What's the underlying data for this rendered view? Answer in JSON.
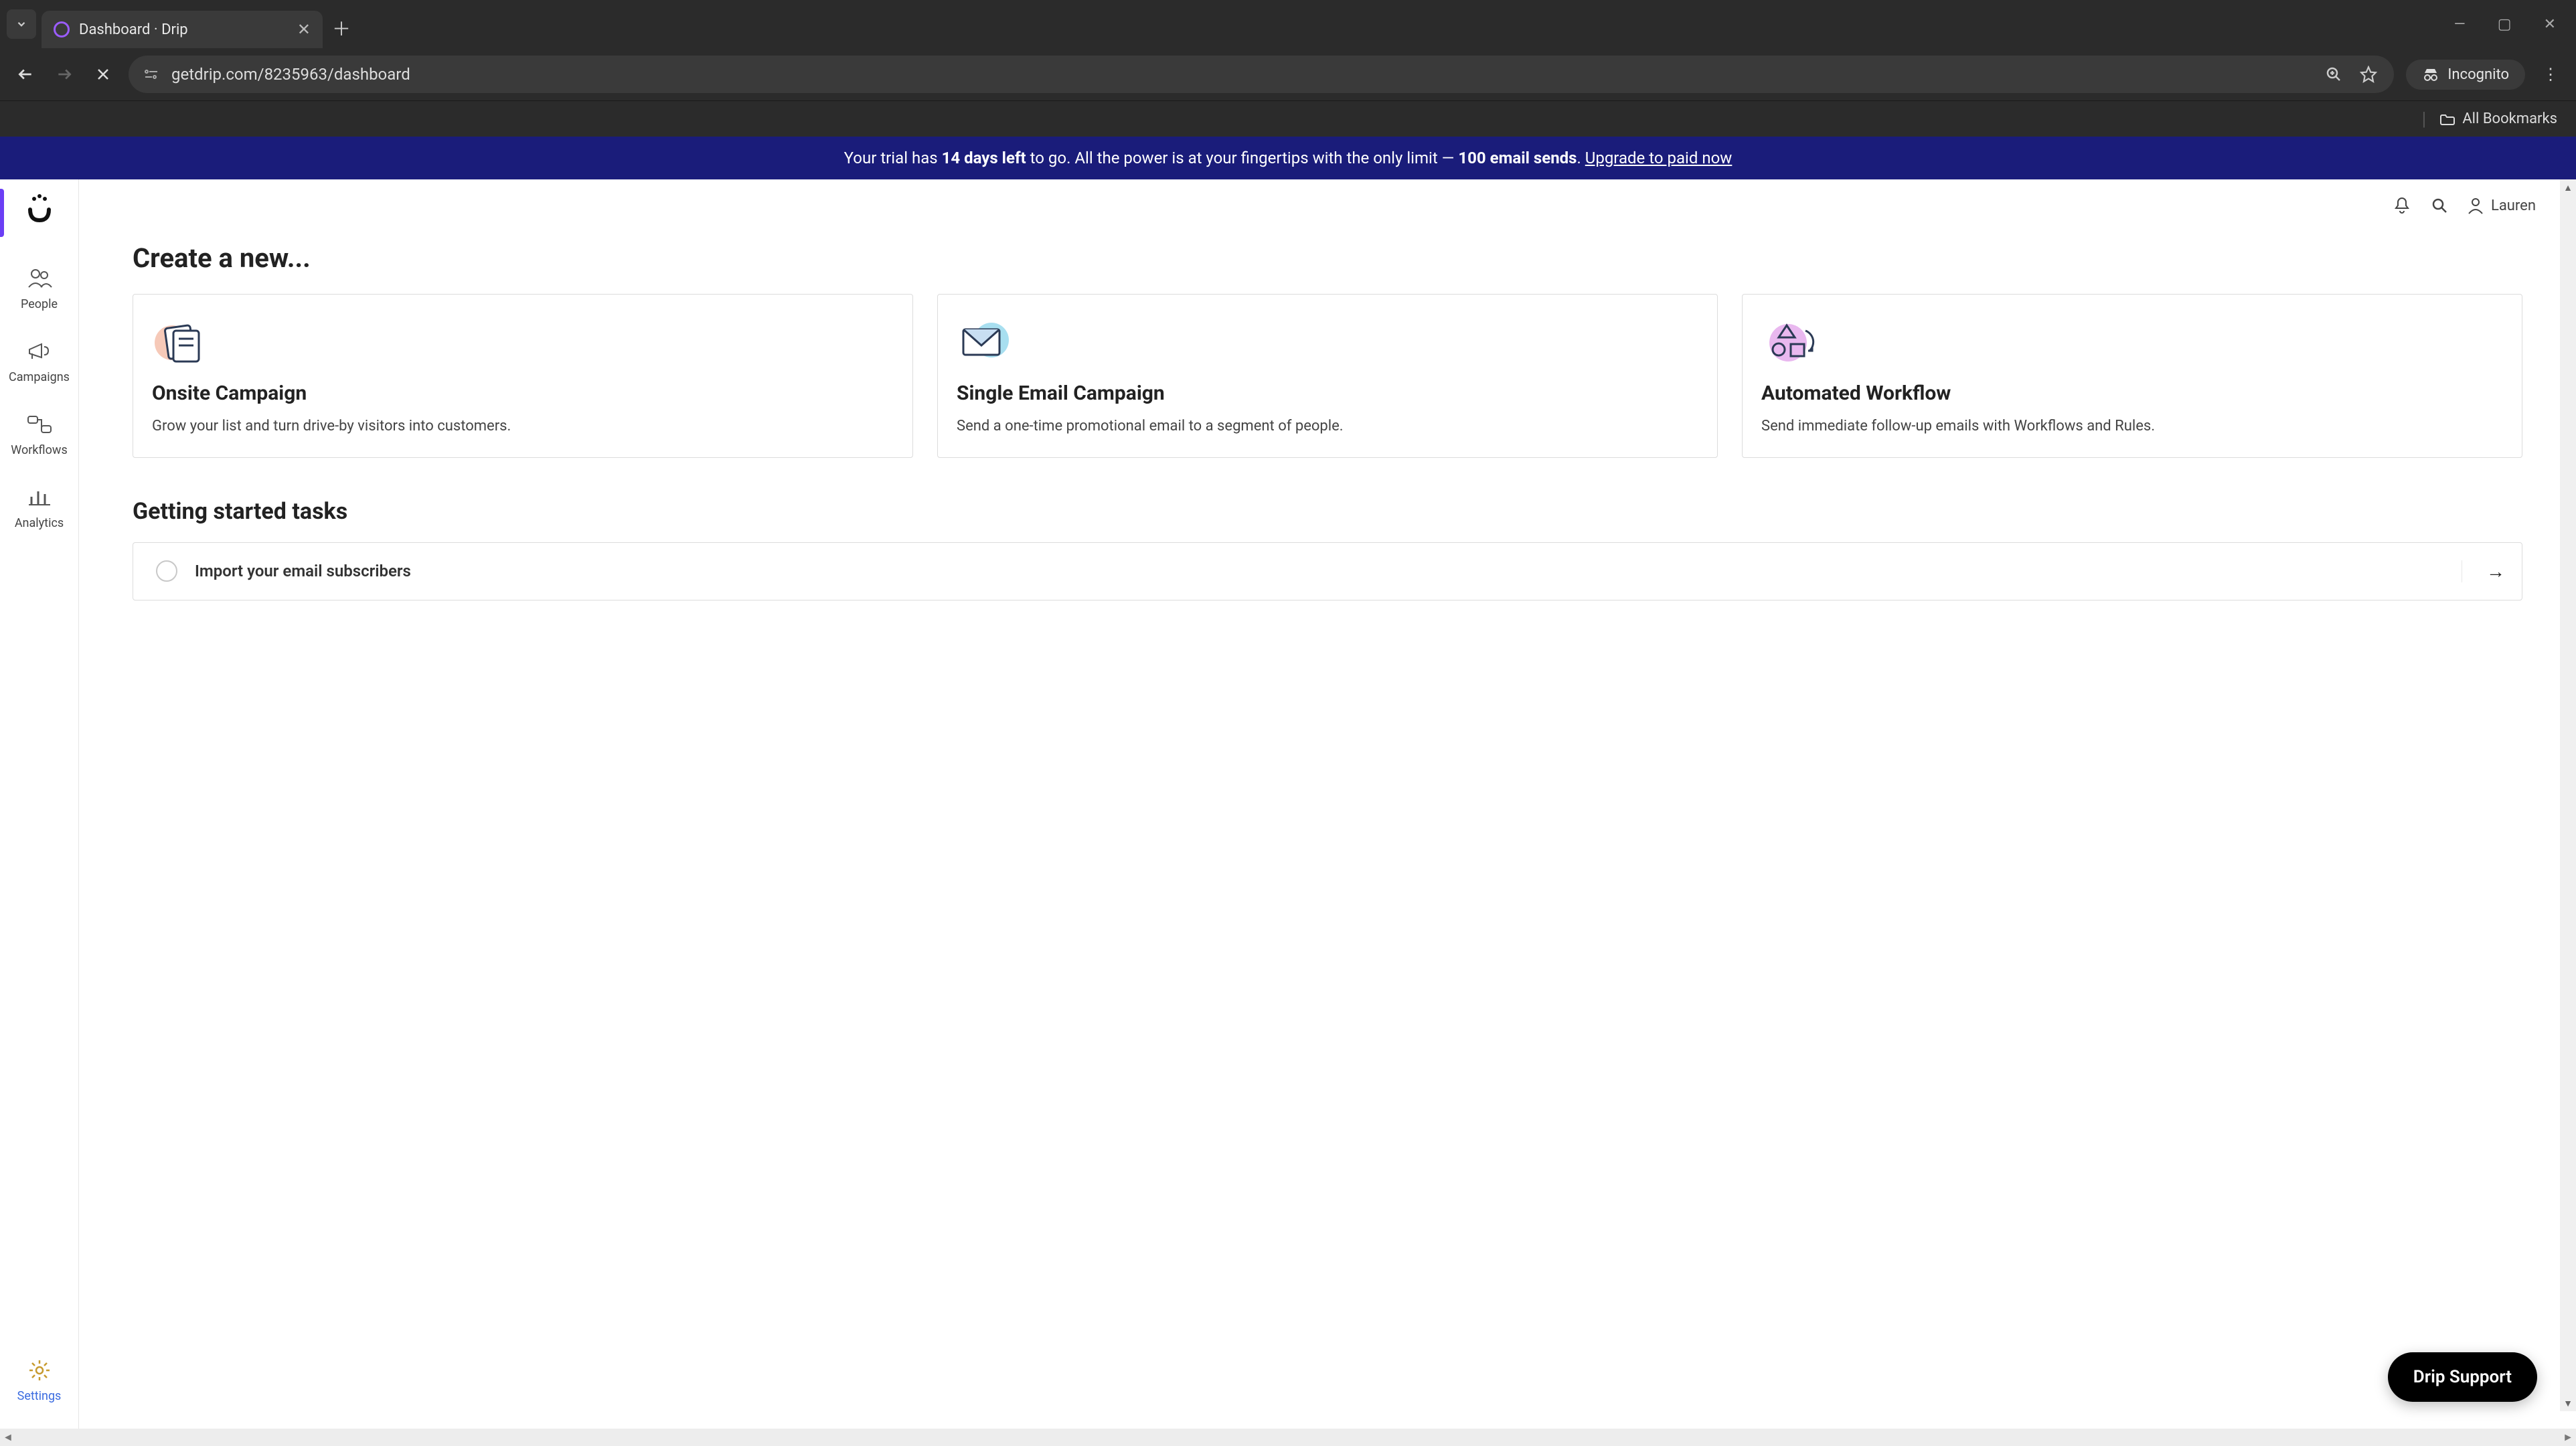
{
  "browser": {
    "tab_title": "Dashboard · Drip",
    "url": "getdrip.com/8235963/dashboard",
    "incognito_label": "Incognito",
    "bookmarks_label": "All Bookmarks"
  },
  "banner": {
    "prefix": "Your trial has ",
    "days_left": "14 days left",
    "middle": " to go. All the power is at your fingertips with the only limit — ",
    "limit": "100 email sends",
    "suffix": ". ",
    "cta": "Upgrade to paid now"
  },
  "sidebar": {
    "items": [
      {
        "label": "People"
      },
      {
        "label": "Campaigns"
      },
      {
        "label": "Workflows"
      },
      {
        "label": "Analytics"
      }
    ],
    "settings_label": "Settings"
  },
  "topbar": {
    "user_name": "Lauren"
  },
  "create_section": {
    "heading": "Create a new...",
    "cards": [
      {
        "title": "Onsite Campaign",
        "desc": "Grow your list and turn drive-by visitors into customers."
      },
      {
        "title": "Single Email Campaign",
        "desc": "Send a one-time promotional email to a segment of people."
      },
      {
        "title": "Automated Workflow",
        "desc": "Send immediate follow-up emails with Workflows and Rules."
      }
    ]
  },
  "tasks_section": {
    "heading": "Getting started tasks",
    "tasks": [
      {
        "label": "Import your email subscribers"
      }
    ]
  },
  "support_label": "Drip Support"
}
